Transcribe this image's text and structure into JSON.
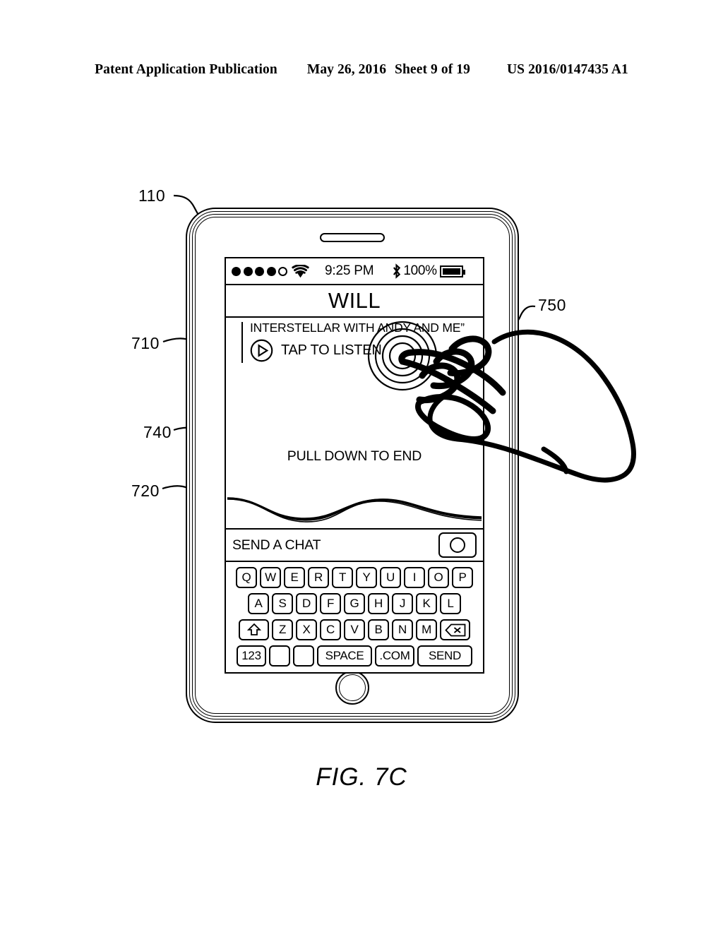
{
  "page_header": {
    "publication": "Patent Application Publication",
    "date": "May 26, 2016",
    "sheet": "Sheet 9 of 19",
    "pub_number": "US 2016/0147435 A1"
  },
  "figure": {
    "caption": "FIG. 7C"
  },
  "reference_numerals": {
    "device": "110",
    "story_area": "710",
    "chat_bar": "720",
    "progress_wave": "740",
    "touch_gesture": "750"
  },
  "device": {
    "status_bar": {
      "signal_dots_filled": 4,
      "signal_dots_empty": 1,
      "wifi_icon": "wifi-icon",
      "time": "9:25 PM",
      "bluetooth_icon": "bluetooth-icon",
      "battery_percent": "100%",
      "battery_icon": "battery-icon"
    },
    "title_bar": {
      "title": "WILL"
    },
    "story": {
      "message": "INTERSTELLAR WITH ANDY AND ME”",
      "play_icon": "play-circle-icon",
      "listen_label": "TAP TO LISTEN",
      "pull_down_label": "PULL DOWN TO END"
    },
    "chat_bar": {
      "placeholder": "SEND A CHAT",
      "camera_icon": "camera-shutter-icon"
    },
    "keyboard": {
      "row1": [
        "Q",
        "W",
        "E",
        "R",
        "T",
        "Y",
        "U",
        "I",
        "O",
        "P"
      ],
      "row2": [
        "A",
        "S",
        "D",
        "F",
        "G",
        "H",
        "J",
        "K",
        "L"
      ],
      "row3": [
        "Z",
        "X",
        "C",
        "V",
        "B",
        "N",
        "M"
      ],
      "shift_icon": "shift-up-arrow-icon",
      "delete_icon": "backspace-delete-icon",
      "numeric_key": "123",
      "blank_key_1": "",
      "blank_key_2": "",
      "space_key": "SPACE",
      "dotcom_key": ".COM",
      "send_key": "SEND"
    }
  },
  "colors": {
    "ink": "#000000",
    "paper": "#ffffff"
  }
}
